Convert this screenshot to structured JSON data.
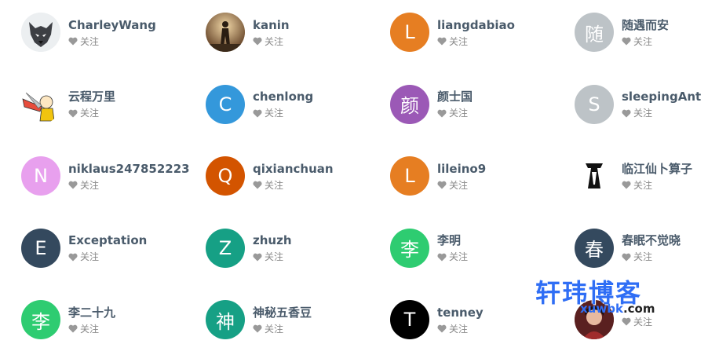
{
  "users": [
    {
      "name": "CharleyWang",
      "avatar_letter": "",
      "avatar_color": "#e9ecef",
      "avatar_icon": "wolf-avatar-icon",
      "follow_label": "关注"
    },
    {
      "name": "kanin",
      "avatar_letter": "",
      "avatar_color": "#b08a5e",
      "avatar_icon": "silhouette-photo-avatar-icon",
      "follow_label": "关注"
    },
    {
      "name": "liangdabiao",
      "avatar_letter": "L",
      "avatar_color": "#e67e22",
      "avatar_icon": "",
      "follow_label": "关注"
    },
    {
      "name": "随遇而安",
      "avatar_letter": "随",
      "avatar_color": "#bdc3c7",
      "avatar_icon": "",
      "follow_label": "关注"
    },
    {
      "name": "云程万里",
      "avatar_letter": "",
      "avatar_color": "#ffffff",
      "avatar_icon": "anime-hero-avatar-icon",
      "follow_label": "关注"
    },
    {
      "name": "chenlong",
      "avatar_letter": "C",
      "avatar_color": "#3498db",
      "avatar_icon": "",
      "follow_label": "关注"
    },
    {
      "name": "颜士国",
      "avatar_letter": "颜",
      "avatar_color": "#9b59b6",
      "avatar_icon": "",
      "follow_label": "关注"
    },
    {
      "name": "sleepingAnt",
      "avatar_letter": "S",
      "avatar_color": "#bdc3c7",
      "avatar_icon": "",
      "follow_label": "关注"
    },
    {
      "name": "niklaus247852223",
      "avatar_letter": "N",
      "avatar_color": "#e8a0ee",
      "avatar_icon": "",
      "follow_label": "关注"
    },
    {
      "name": "qixianchuan",
      "avatar_letter": "Q",
      "avatar_color": "#d35400",
      "avatar_icon": "",
      "follow_label": "关注"
    },
    {
      "name": "lileino9",
      "avatar_letter": "L",
      "avatar_color": "#e67e22",
      "avatar_icon": "",
      "follow_label": "关注"
    },
    {
      "name": "临江仙卜算子",
      "avatar_letter": "",
      "avatar_color": "#ffffff",
      "avatar_icon": "black-logo-avatar-icon",
      "follow_label": "关注"
    },
    {
      "name": "Exceptation",
      "avatar_letter": "E",
      "avatar_color": "#34495e",
      "avatar_icon": "",
      "follow_label": "关注"
    },
    {
      "name": "zhuzh",
      "avatar_letter": "Z",
      "avatar_color": "#16a085",
      "avatar_icon": "",
      "follow_label": "关注"
    },
    {
      "name": "李明",
      "avatar_letter": "李",
      "avatar_color": "#2ecc71",
      "avatar_icon": "",
      "follow_label": "关注"
    },
    {
      "name": "春眠不觉晓",
      "avatar_letter": "春",
      "avatar_color": "#34495e",
      "avatar_icon": "",
      "follow_label": "关注"
    },
    {
      "name": "李二十九",
      "avatar_letter": "李",
      "avatar_color": "#2ecc71",
      "avatar_icon": "",
      "follow_label": "关注"
    },
    {
      "name": "神秘五香豆",
      "avatar_letter": "神",
      "avatar_color": "#16a085",
      "avatar_icon": "",
      "follow_label": "关注"
    },
    {
      "name": "tenney",
      "avatar_letter": "T",
      "avatar_color": "#000000",
      "avatar_icon": "",
      "follow_label": "关注"
    },
    {
      "name": "",
      "avatar_letter": "",
      "avatar_color": "#6b2a2a",
      "avatar_icon": "portrait-photo-avatar-icon",
      "follow_label": "关注"
    }
  ],
  "watermark": {
    "title": "轩玮博客",
    "domain_main": "xuwbk",
    "domain_tld": ".com"
  }
}
